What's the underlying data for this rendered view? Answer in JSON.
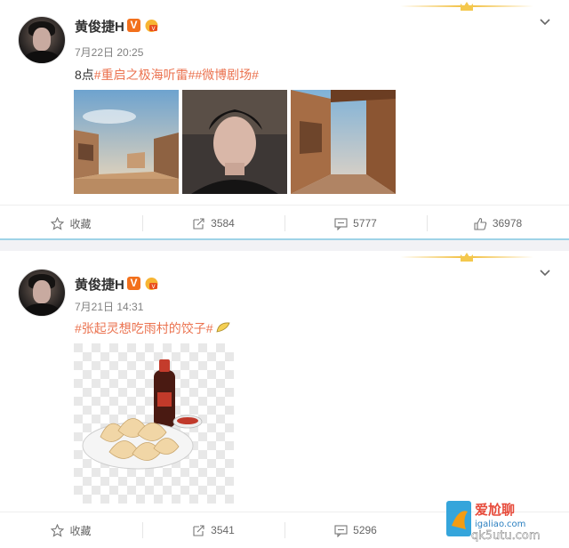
{
  "posts": [
    {
      "author": "黄俊捷H",
      "verified_badge": "V",
      "time": "7月22日 20:25",
      "content_prefix": "8点",
      "topics": [
        "#重启之极海听雷#",
        "#微博剧场#"
      ],
      "images": [
        "desert-town-street-photo",
        "selfie-photo",
        "alley-ruins-photo"
      ],
      "actions": {
        "favorite_label": "收藏",
        "repost_count": "3584",
        "comment_count": "5777",
        "like_count": "36978"
      }
    },
    {
      "author": "黄俊捷H",
      "verified_badge": "V",
      "time": "7月21日 14:31",
      "topics": [
        "#张起灵想吃雨村的饺子#"
      ],
      "emoji": "dumpling-emoji",
      "images": [
        "dumplings-soy-sauce-illustration"
      ],
      "actions": {
        "favorite_label": "收藏",
        "repost_count": "3541",
        "comment_count": "5296"
      }
    }
  ],
  "watermark": {
    "brand": "爱尬聊",
    "site_top": "igaliao.com",
    "site_bottom": "qk5utu.com"
  },
  "colors": {
    "topic": "#eb7350",
    "badge": "#f2701c",
    "divider_accent": "#9fd3e7"
  }
}
